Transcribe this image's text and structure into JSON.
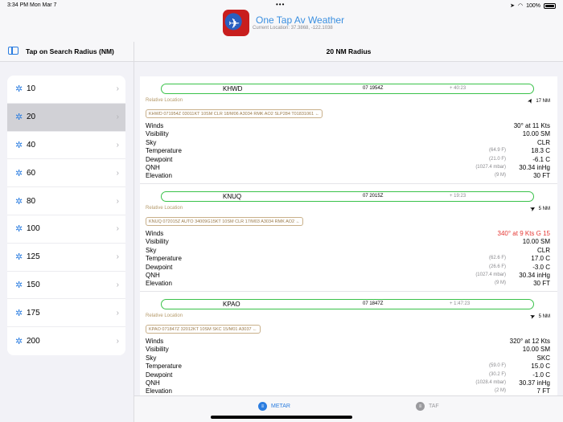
{
  "status_bar": {
    "time": "3:34 PM",
    "date": "Mon Mar 7",
    "battery": "100%"
  },
  "app": {
    "title": "One Tap Av Weather",
    "subtitle": "Current Location: 37.3868, -122.1038"
  },
  "left": {
    "title": "Tap on Search Radius (NM)",
    "items": [
      {
        "label": "10"
      },
      {
        "label": "20",
        "selected": true
      },
      {
        "label": "40"
      },
      {
        "label": "60"
      },
      {
        "label": "80"
      },
      {
        "label": "100"
      },
      {
        "label": "125"
      },
      {
        "label": "150"
      },
      {
        "label": "175"
      },
      {
        "label": "200"
      }
    ]
  },
  "right": {
    "title": "20 NM Radius"
  },
  "stations": [
    {
      "id": "KHWD",
      "time": "07 1954Z",
      "age": "+ 40:23",
      "rel": "Relative Location",
      "dist": "17 NM",
      "arrow_rotation_deg": 30,
      "raw": "KHWD 071954Z 03011KT 10SM CLR 18/M06 A3034 RMK AO2 SLP284 T01831061 ←",
      "rows": [
        {
          "label": "Winds",
          "value": "30° at 11 Kts",
          "secondary": ""
        },
        {
          "label": "Visibility",
          "value": "10.00 SM",
          "secondary": ""
        },
        {
          "label": "Sky",
          "value": "CLR",
          "secondary": ""
        },
        {
          "label": "Temperature",
          "value": "18.3 C",
          "secondary": "(64.9 F)"
        },
        {
          "label": "Dewpoint",
          "value": "-6.1 C",
          "secondary": "(21.0 F)"
        },
        {
          "label": "QNH",
          "value": "30.34 inHg",
          "secondary": "(1027.4 mbar)"
        },
        {
          "label": "Elevation",
          "value": "30 FT",
          "secondary": "(9 M)"
        }
      ]
    },
    {
      "id": "KNUQ",
      "time": "07 2015Z",
      "age": "+ 19:23",
      "rel": "Relative Location",
      "dist": "5 NM",
      "arrow_rotation_deg": 60,
      "raw": "KNUQ 072015Z AUTO 34009G15KT 10SM CLR 17/M03 A3034 RMK AO2 ←",
      "rows": [
        {
          "label": "Winds",
          "value": "340° at 9 Kts G 15",
          "secondary": "",
          "alert": true
        },
        {
          "label": "Visibility",
          "value": "10.00 SM",
          "secondary": ""
        },
        {
          "label": "Sky",
          "value": "CLR",
          "secondary": ""
        },
        {
          "label": "Temperature",
          "value": "17.0 C",
          "secondary": "(62.6 F)"
        },
        {
          "label": "Dewpoint",
          "value": "-3.0 C",
          "secondary": "(26.6 F)"
        },
        {
          "label": "QNH",
          "value": "30.34 inHg",
          "secondary": "(1027.4 mbar)"
        },
        {
          "label": "Elevation",
          "value": "30 FT",
          "secondary": "(9 M)"
        }
      ]
    },
    {
      "id": "KPAO",
      "time": "07 1847Z",
      "age": "+ 1:47:23",
      "rel": "Relative Location",
      "dist": "5 NM",
      "arrow_rotation_deg": 70,
      "raw": "KPAO 071847Z 32012KT 10SM SKC 15/M01 A3037 ←",
      "rows": [
        {
          "label": "Winds",
          "value": "320° at 12 Kts",
          "secondary": ""
        },
        {
          "label": "Visibility",
          "value": "10.00 SM",
          "secondary": ""
        },
        {
          "label": "Sky",
          "value": "SKC",
          "secondary": ""
        },
        {
          "label": "Temperature",
          "value": "15.0 C",
          "secondary": "(59.0 F)"
        },
        {
          "label": "Dewpoint",
          "value": "-1.0 C",
          "secondary": "(30.2 F)"
        },
        {
          "label": "QNH",
          "value": "30.37 inHg",
          "secondary": "(1028.4 mbar)"
        },
        {
          "label": "Elevation",
          "value": "7 FT",
          "secondary": "(2 M)"
        }
      ]
    }
  ],
  "tabs": {
    "metar": "METAR",
    "taf": "TAF"
  },
  "colors": {
    "accent": "#2b7de0",
    "station_border": "#3ac24a",
    "alert": "#e53935"
  }
}
